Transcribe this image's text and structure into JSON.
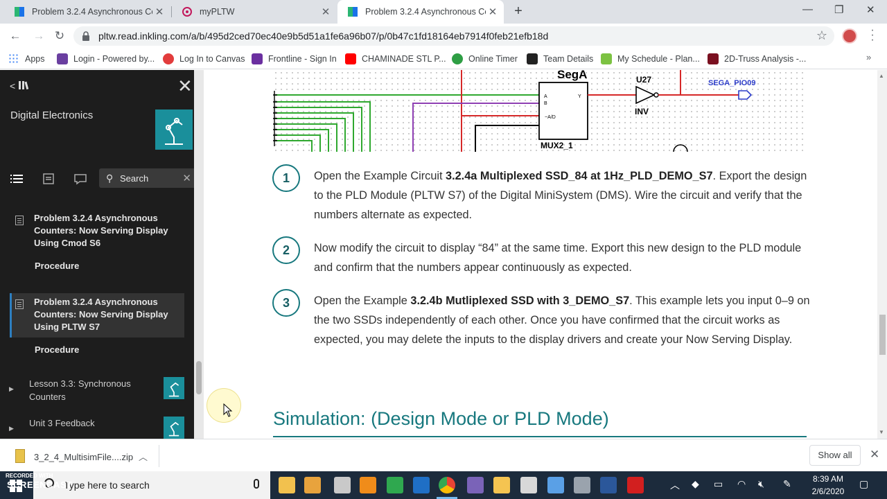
{
  "browser": {
    "tabs": [
      {
        "title": "Problem 3.2.4 Asynchronous Cou",
        "active": false
      },
      {
        "title": "myPLTW",
        "active": false
      },
      {
        "title": "Problem 3.2.4 Asynchronous Cou",
        "active": true
      }
    ],
    "url": "pltw.read.inkling.com/a/b/495d2ced70ec40e9b5d51a1fe6a96b07/p/0b47c1fd18164eb7914f0feb21efb18d",
    "bookmarks": [
      {
        "label": "Apps",
        "icon_color": "#4285f4"
      },
      {
        "label": "Login - Powered by...",
        "icon_color": "#6a3fa0"
      },
      {
        "label": "Log In to Canvas",
        "icon_color": "#e23c3c"
      },
      {
        "label": "Frontline - Sign In",
        "icon_color": "#6b2fa0"
      },
      {
        "label": "CHAMINADE STL P...",
        "icon_color": "#ff0000"
      },
      {
        "label": "Online Timer",
        "icon_color": "#2e9e44"
      },
      {
        "label": "Team Details",
        "icon_color": "#222222"
      },
      {
        "label": "My Schedule - Plan...",
        "icon_color": "#7cc242"
      },
      {
        "label": "2D-Truss Analysis -...",
        "icon_color": "#7a1020"
      }
    ]
  },
  "sidebar": {
    "back_label": "<",
    "book_title": "Digital Electronics",
    "search_label": "Search",
    "items": [
      {
        "title": "Problem 3.2.4 Asynchronous Counters: Now Serving Display Using Cmod S6",
        "sub": "Procedure"
      },
      {
        "title": "Problem 3.2.4 Asynchronous Counters: Now Serving Display Using PLTW S7",
        "sub": "Procedure"
      }
    ],
    "lessons": [
      {
        "title": "Lesson 3.3: Synchronous Counters"
      },
      {
        "title": "Unit 3 Feedback"
      }
    ]
  },
  "content": {
    "circuit_labels": {
      "seg": "SegA",
      "u27": "U27",
      "inv": "INV",
      "probe": "SEGA_PIO09",
      "mux": "MUX2_1"
    },
    "steps": [
      {
        "num": "1",
        "pre": "Open the Example Circuit ",
        "bold": "3.2.4a Multiplexed SSD_84 at 1Hz_PLD_DEMO_S7",
        "post": ". Export the design to the PLD Module (PLTW S7) of the Digital MiniSystem (DMS). Wire the circuit and verify that the numbers alternate as expected."
      },
      {
        "num": "2",
        "pre": "Now modify the circuit to display “84” at the same time. Export this new design to the PLD module and confirm that the numbers appear continuously as expected.",
        "bold": "",
        "post": ""
      },
      {
        "num": "3",
        "pre": "Open the Example ",
        "bold": "3.2.4b Mutliplexed SSD with 3_DEMO_S7",
        "post": ". This example lets you input 0–9 on the two SSDs independently of each other. Once you have confirmed that the circuit works as expected, you may delete the inputs to the display drivers and create your Now Serving Display."
      }
    ],
    "section_heading": "Simulation: (Design Mode or PLD Mode)"
  },
  "downloads": {
    "file": "3_2_4_MultisimFile....zip",
    "show_all": "Show all"
  },
  "taskbar": {
    "recorded_with": "RECORDED WITH",
    "screencast": "SCREENCAST",
    "search_placeholder": "Type here to search",
    "time": "8:39 AM",
    "date": "2/6/2020"
  }
}
